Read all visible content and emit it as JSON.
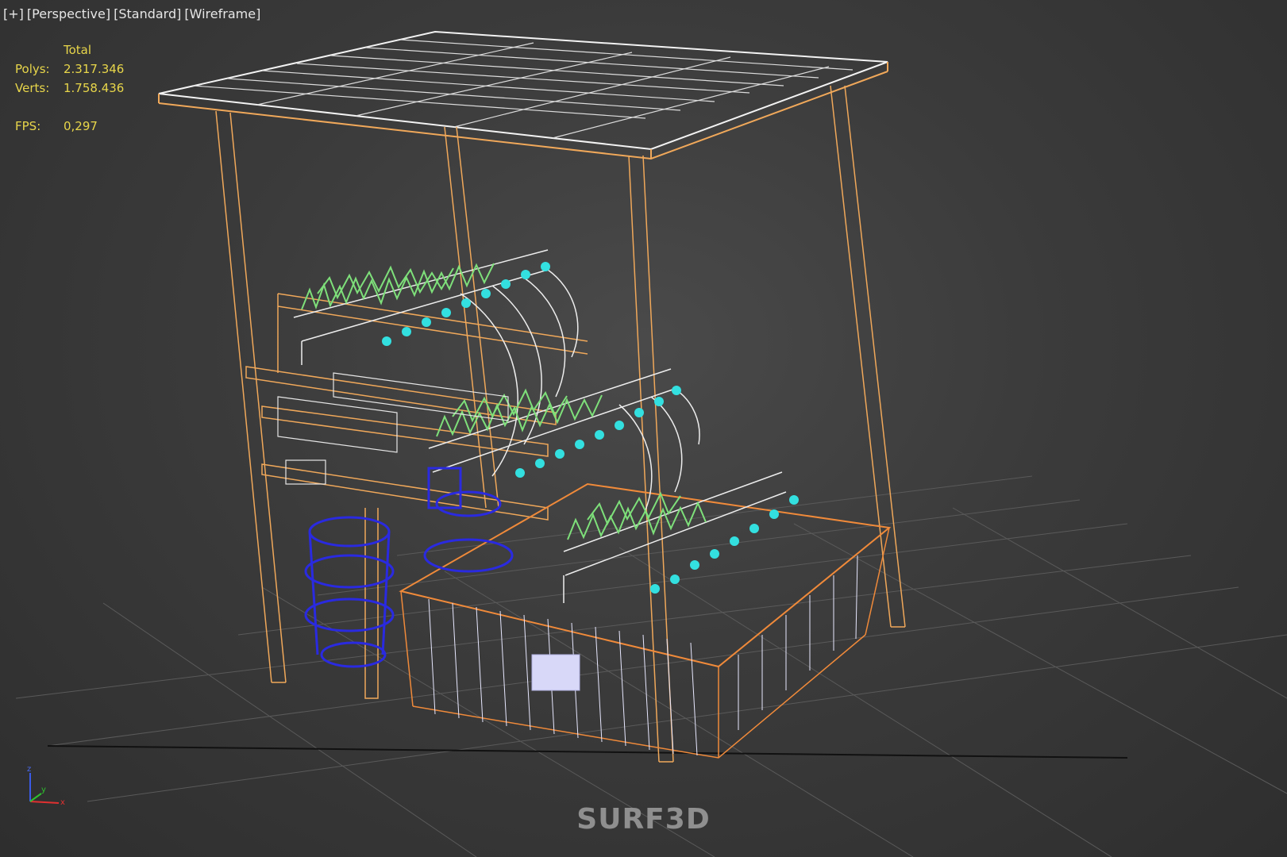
{
  "viewport": {
    "labels": [
      "+",
      "Perspective",
      "Standard",
      "Wireframe"
    ]
  },
  "stats": {
    "header": "Total",
    "polys_label": "Polys:",
    "polys_value": "2.317.346",
    "verts_label": "Verts:",
    "verts_value": "1.758.436",
    "fps_label": "FPS:",
    "fps_value": "0,297"
  },
  "axis": {
    "z": "z",
    "y": "y",
    "x": "x"
  },
  "watermark": "SURF3D",
  "colors": {
    "frame": "#f0a85a",
    "panel": "#ffffff",
    "plants": "#7ee07a",
    "emitters": "#33e0e0",
    "buckets": "#2a2ae0",
    "tank": "#f08a3a",
    "grid": "#555555",
    "stats_text": "#e8d64a"
  }
}
